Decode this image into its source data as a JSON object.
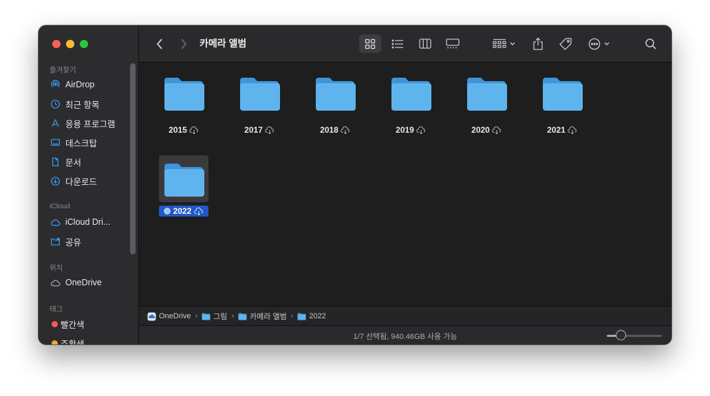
{
  "window": {
    "title": "카메라 앨범"
  },
  "sidebar": {
    "sections": [
      {
        "label": "즐겨찾기"
      },
      {
        "label": "iCloud"
      },
      {
        "label": "위치"
      },
      {
        "label": "태그"
      }
    ],
    "favorites": [
      {
        "label": "AirDrop",
        "icon": "airdrop-icon"
      },
      {
        "label": "최근 항목",
        "icon": "clock-icon"
      },
      {
        "label": "응용 프로그램",
        "icon": "applications-icon"
      },
      {
        "label": "데스크탑",
        "icon": "desktop-icon"
      },
      {
        "label": "문서",
        "icon": "document-icon"
      },
      {
        "label": "다운로드",
        "icon": "download-icon"
      }
    ],
    "icloud": [
      {
        "label": "iCloud Dri...",
        "icon": "icloud-icon"
      },
      {
        "label": "공유",
        "icon": "shared-folder-icon"
      }
    ],
    "locations": [
      {
        "label": "OneDrive",
        "icon": "cloud-icon"
      }
    ],
    "tags": [
      {
        "label": "빨간색",
        "color": "#ff5a52"
      },
      {
        "label": "주황색",
        "color": "#f9a825"
      }
    ]
  },
  "folders": [
    {
      "name": "2015"
    },
    {
      "name": "2017"
    },
    {
      "name": "2018"
    },
    {
      "name": "2019"
    },
    {
      "name": "2020"
    },
    {
      "name": "2021"
    },
    {
      "name": "2022",
      "selected": true
    }
  ],
  "pathbar": [
    "OneDrive",
    "그림",
    "카메라 앨범",
    "2022"
  ],
  "status": {
    "text": "1/7 선택됨, 940.46GB 사용 가능",
    "icon_size": 0.25
  },
  "colors": {
    "accent": "#2357c9",
    "folder": "#5fb4ee",
    "folder_dark": "#3f95d8"
  }
}
